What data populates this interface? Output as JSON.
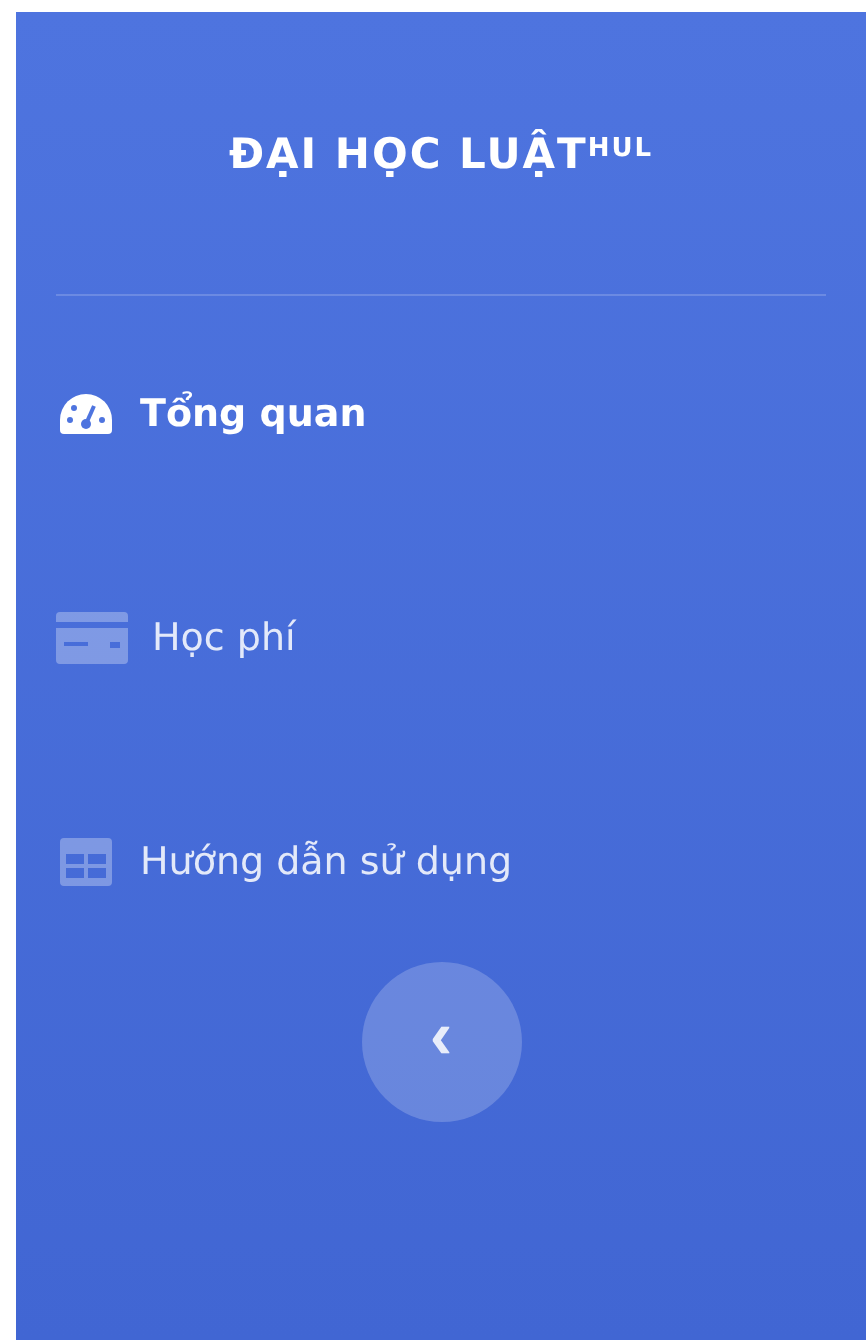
{
  "brand": {
    "title": "ĐẠI HỌC LUẬT$^{HUL}$"
  },
  "nav_items": [
    {
      "label": "Tổng quan",
      "selected": true
    },
    {
      "label": "Học phí",
      "selected": false
    },
    {
      "label": "Hướng dẫn sử dụng",
      "selected": false
    }
  ],
  "toggle_button": {
    "label": "‹"
  }
}
